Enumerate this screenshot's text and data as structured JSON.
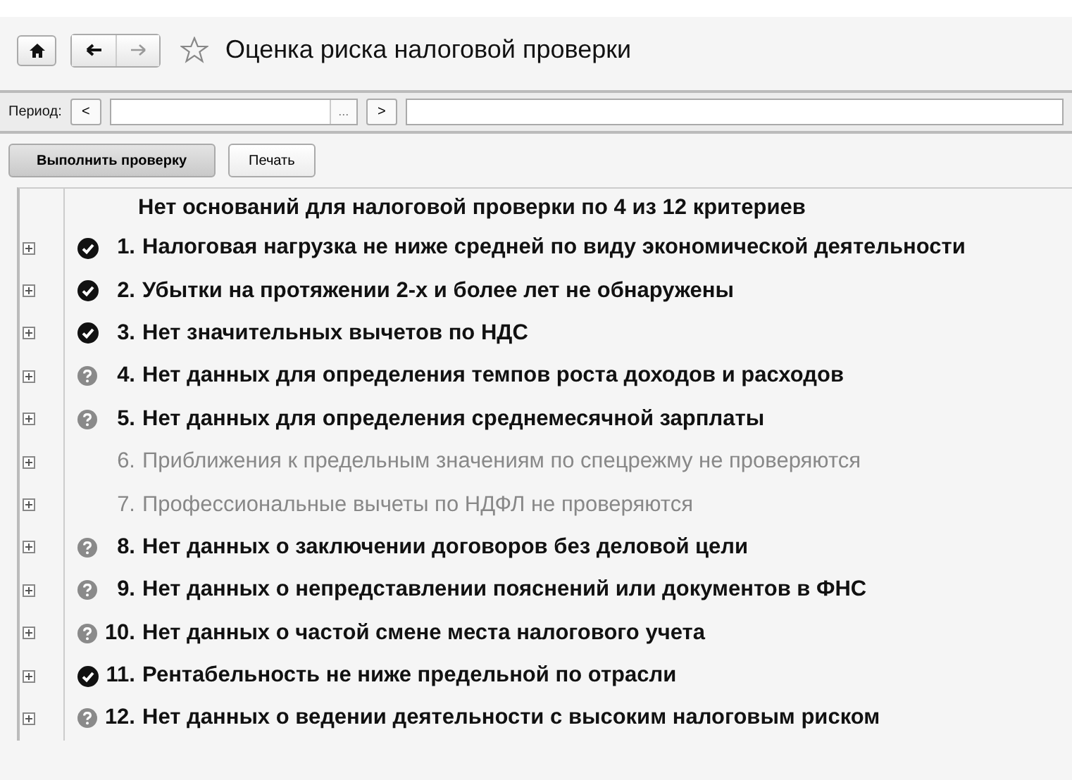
{
  "window": {
    "title": "Оценка риска налоговой проверки",
    "favorite": false
  },
  "period": {
    "label": "Период:",
    "prev": "<",
    "picker": "...",
    "next": ">"
  },
  "buttons": [
    {
      "label": "Выполнить проверку",
      "kind": "primary"
    },
    {
      "label": "Печать",
      "kind": "plain"
    }
  ],
  "summary": "Нет оснований для налоговой проверки по 4 из 12 критериев",
  "criteria": [
    {
      "number": "1.",
      "text": "Налоговая нагрузка не ниже средней по виду экономической деятельности",
      "kind": "passed"
    },
    {
      "number": "2.",
      "text": "Убытки на протяжении 2-х и более лет не обнаружены",
      "kind": "passed"
    },
    {
      "number": "3.",
      "text": "Нет значительных вычетов по НДС",
      "kind": "passed"
    },
    {
      "number": "4.",
      "text": "Нет данных для определения темпов роста доходов и расходов",
      "kind": "no_data"
    },
    {
      "number": "5.",
      "text": "Нет данных для определения среднемесячной зарплаты",
      "kind": "no_data"
    },
    {
      "number": "6.",
      "text": "Приближения к предельным значениям по спецрежму не проверяются",
      "kind": "not_checked"
    },
    {
      "number": "7.",
      "text": "Профессиональные вычеты по НДФЛ не проверяются",
      "kind": "not_checked"
    },
    {
      "number": "8.",
      "text": "Нет данных о заключении договоров без деловой цели",
      "kind": "no_data"
    },
    {
      "number": "9.",
      "text": "Нет данных о непредставлении пояснений или документов в ФНС",
      "kind": "no_data"
    },
    {
      "number": "10.",
      "text": "Нет данных о частой смене места налогового учета",
      "kind": "no_data"
    },
    {
      "number": "11.",
      "text": "Рентабельность не ниже предельной по отрасли",
      "kind": "passed"
    },
    {
      "number": "12.",
      "text": "Нет данных о ведении деятельности с высоким налоговым риском",
      "kind": "no_data"
    }
  ]
}
